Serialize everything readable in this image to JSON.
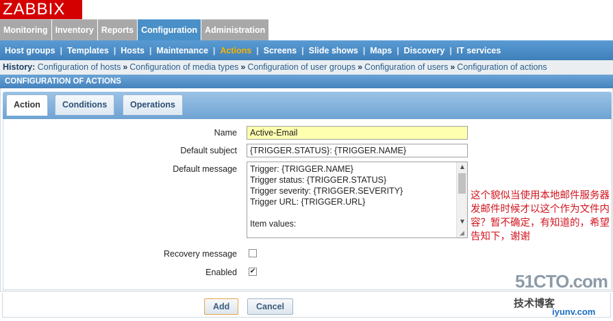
{
  "logo": "ZABBIX",
  "main_menu": [
    {
      "label": "Monitoring",
      "active": false
    },
    {
      "label": "Inventory",
      "active": false
    },
    {
      "label": "Reports",
      "active": false
    },
    {
      "label": "Configuration",
      "active": true
    },
    {
      "label": "Administration",
      "active": false
    }
  ],
  "sub_menu": [
    {
      "label": "Host groups",
      "active": false
    },
    {
      "label": "Templates",
      "active": false
    },
    {
      "label": "Hosts",
      "active": false
    },
    {
      "label": "Maintenance",
      "active": false
    },
    {
      "label": "Actions",
      "active": true
    },
    {
      "label": "Screens",
      "active": false
    },
    {
      "label": "Slide shows",
      "active": false
    },
    {
      "label": "Maps",
      "active": false
    },
    {
      "label": "Discovery",
      "active": false
    },
    {
      "label": "IT services",
      "active": false
    }
  ],
  "history": {
    "label": "History:",
    "items": [
      "Configuration of hosts",
      "Configuration of media types",
      "Configuration of user groups",
      "Configuration of users",
      "Configuration of actions"
    ],
    "separator": "»"
  },
  "page_title": "CONFIGURATION OF ACTIONS",
  "form_tabs": [
    {
      "label": "Action",
      "active": true
    },
    {
      "label": "Conditions",
      "active": false
    },
    {
      "label": "Operations",
      "active": false
    }
  ],
  "form": {
    "name_label": "Name",
    "name_value": "Active-Email",
    "subject_label": "Default subject",
    "subject_value": "{TRIGGER.STATUS}: {TRIGGER.NAME}",
    "message_label": "Default message",
    "message_lines": [
      "Trigger: {TRIGGER.NAME}",
      "Trigger status: {TRIGGER.STATUS}",
      "Trigger severity: {TRIGGER.SEVERITY}",
      "Trigger URL: {TRIGGER.URL}",
      "",
      "Item values:"
    ],
    "recovery_label": "Recovery message",
    "recovery_checked": false,
    "enabled_label": "Enabled",
    "enabled_checked": true
  },
  "annotation": "这个貌似当使用本地邮件服务器发邮件时候才以这个作为文件内容？暂不确定，有知道的，希望告知下，谢谢",
  "buttons": {
    "add": "Add",
    "cancel": "Cancel"
  },
  "watermark": {
    "site": "51CTO.com",
    "line2": "技术博客",
    "url": "iyunv.com"
  },
  "colors": {
    "brand_red": "#d40000",
    "active_tab": "#4a90c8",
    "active_submenu": "#f5b300",
    "annotation_red": "#d0141e",
    "focused_input": "#ffffb0"
  }
}
